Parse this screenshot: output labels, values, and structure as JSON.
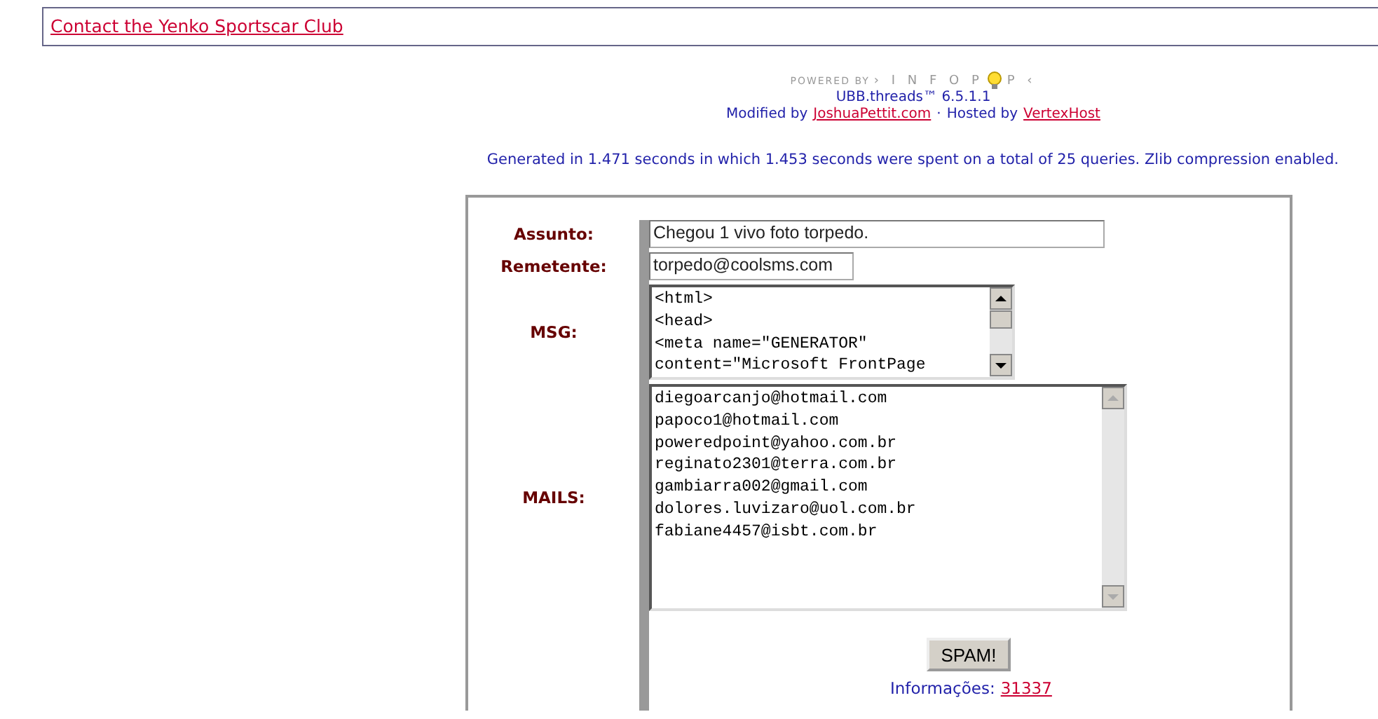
{
  "header": {
    "link": "Contact the Yenko Sportscar Club"
  },
  "footer": {
    "powered_by": "POWERED BY",
    "logo_left": "› I N F O P",
    "logo_right": "P ‹",
    "version": "UBB.threads™ 6.5.1.1",
    "modified_by": "Modified by",
    "modified_link": "JoshuaPettit.com",
    "separator": "·",
    "hosted_by": "Hosted by",
    "hosted_link": "VertexHost",
    "generated": "Generated in 1.471 seconds in which 1.453 seconds were spent on a total of 25 queries. Zlib compression enabled."
  },
  "form": {
    "fields": [
      {
        "kind": "input",
        "label": "Assunto:",
        "value": "Chegou 1 vivo foto torpedo."
      },
      {
        "kind": "input",
        "label": "Remetente:",
        "value": "torpedo@coolsms.com"
      },
      {
        "kind": "textarea",
        "label": "MSG:",
        "lines": [
          "<html>",
          "<head>",
          "<meta name=\"GENERATOR\"",
          "content=\"Microsoft FrontPage"
        ]
      },
      {
        "kind": "textarea",
        "label": "MAILS:",
        "lines": [
          "diegoarcanjo@hotmail.com",
          "papoco1@hotmail.com",
          "poweredpoint@yahoo.com.br",
          "reginato2301@terra.com.br",
          "gambiarra002@gmail.com",
          "dolores.luvizaro@uol.com.br",
          "fabiane4457@isbt.com.br"
        ]
      }
    ],
    "button": "SPAM!",
    "info_label": "Informações:",
    "info_link": "31337"
  }
}
